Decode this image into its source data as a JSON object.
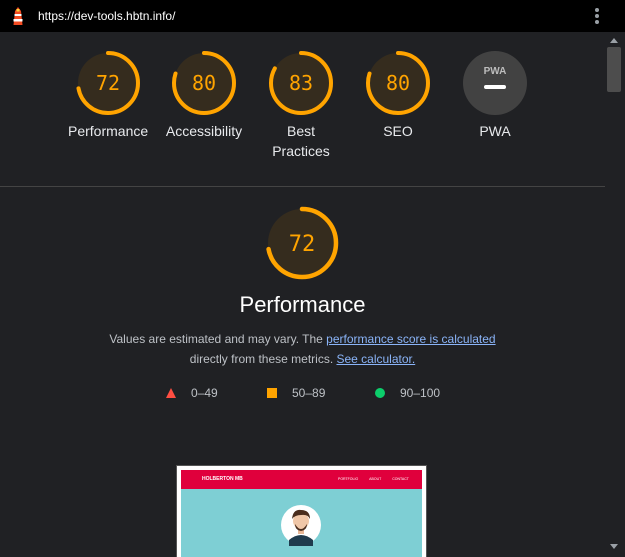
{
  "window": {
    "url": "https://dev-tools.hbtn.info/"
  },
  "colors": {
    "average": "#ffa400",
    "fail": "#ff4e42",
    "pass": "#0cce6b",
    "link": "#8ab4f8",
    "background": "#202124"
  },
  "icons": {
    "logo": "lighthouse-icon",
    "menu": "kebab-menu-icon"
  },
  "gauges": [
    {
      "score": "72",
      "label": "Performance",
      "value": 0.72
    },
    {
      "score": "80",
      "label": "Accessibility",
      "value": 0.8
    },
    {
      "score": "83",
      "label": "Best Practices",
      "value": 0.83
    },
    {
      "score": "80",
      "label": "SEO",
      "value": 0.8
    },
    {
      "label": "PWA",
      "badge": "PWA"
    }
  ],
  "performance": {
    "score": "72",
    "value": 0.72,
    "title": "Performance",
    "desc_before": "Values are estimated and may vary. The ",
    "link_score": "performance score is calculated",
    "desc_middle": "directly from these metrics. ",
    "link_calculator": "See calculator."
  },
  "legend": [
    {
      "shape": "triangle",
      "range": "0–49"
    },
    {
      "shape": "square",
      "range": "50–89"
    },
    {
      "shape": "circle",
      "range": "90–100"
    }
  ],
  "screenshot": {
    "brand": "HOLBERTON MB",
    "links": [
      "PORTFOLIO",
      "ABOUT",
      "CONTACT"
    ]
  }
}
